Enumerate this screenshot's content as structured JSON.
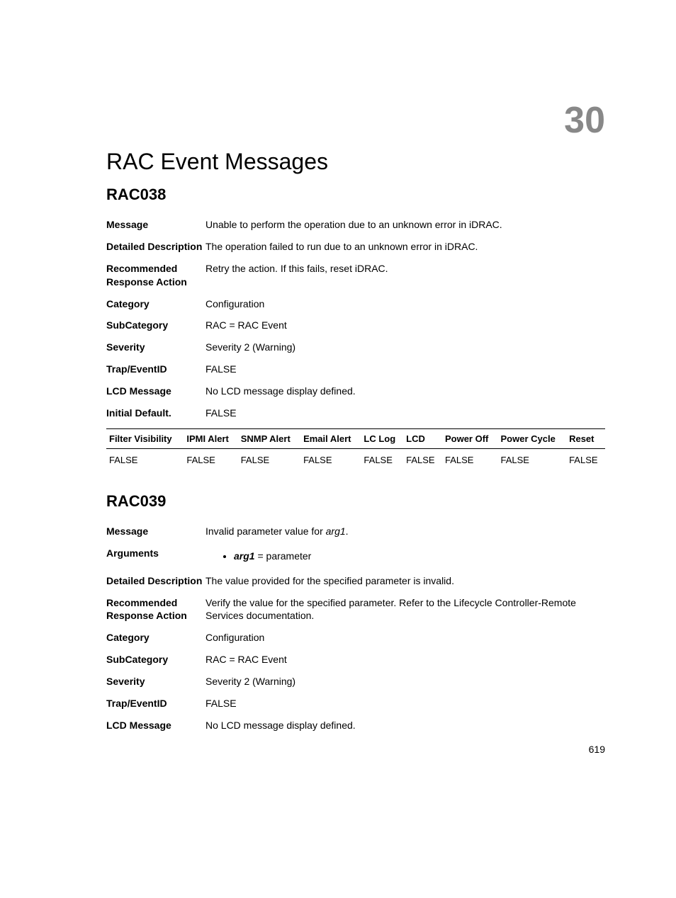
{
  "chapter_number": "30",
  "page_title": "RAC Event Messages",
  "page_number": "619",
  "rac038": {
    "heading": "RAC038",
    "fields": {
      "message_label": "Message",
      "message_value": "Unable to perform the operation due to an unknown error in iDRAC.",
      "detailed_label": "Detailed Description",
      "detailed_value": "The operation failed to run due to an unknown error in iDRAC.",
      "recommended_label": "Recommended Response Action",
      "recommended_value": "Retry the action. If this fails, reset iDRAC.",
      "category_label": "Category",
      "category_value": "Configuration",
      "subcategory_label": "SubCategory",
      "subcategory_value": "RAC = RAC Event",
      "severity_label": "Severity",
      "severity_value": "Severity 2 (Warning)",
      "trap_label": "Trap/EventID",
      "trap_value": "FALSE",
      "lcd_label": "LCD Message",
      "lcd_value": "No LCD message display defined.",
      "initial_label": "Initial Default.",
      "initial_value": "FALSE"
    },
    "table_headers": [
      "Filter Visibility",
      "IPMI Alert",
      "SNMP Alert",
      "Email Alert",
      "LC Log",
      "LCD",
      "Power Off",
      "Power Cycle",
      "Reset"
    ],
    "table_row": [
      "FALSE",
      "FALSE",
      "FALSE",
      "FALSE",
      "FALSE",
      "FALSE",
      "FALSE",
      "FALSE",
      "FALSE"
    ]
  },
  "rac039": {
    "heading": "RAC039",
    "fields": {
      "message_label": "Message",
      "message_prefix": "Invalid parameter value for ",
      "message_arg": "arg1",
      "message_suffix": ".",
      "arguments_label": "Arguments",
      "arg1_name": "arg1",
      "arg1_desc": " = parameter",
      "detailed_label": "Detailed Description",
      "detailed_value": "The value provided for the specified parameter is invalid.",
      "recommended_label": "Recommended Response Action",
      "recommended_value": "Verify the value for the specified parameter. Refer to the Lifecycle Controller-Remote Services documentation.",
      "category_label": "Category",
      "category_value": "Configuration",
      "subcategory_label": "SubCategory",
      "subcategory_value": "RAC = RAC Event",
      "severity_label": "Severity",
      "severity_value": "Severity 2 (Warning)",
      "trap_label": "Trap/EventID",
      "trap_value": "FALSE",
      "lcd_label": "LCD Message",
      "lcd_value": "No LCD message display defined."
    }
  }
}
